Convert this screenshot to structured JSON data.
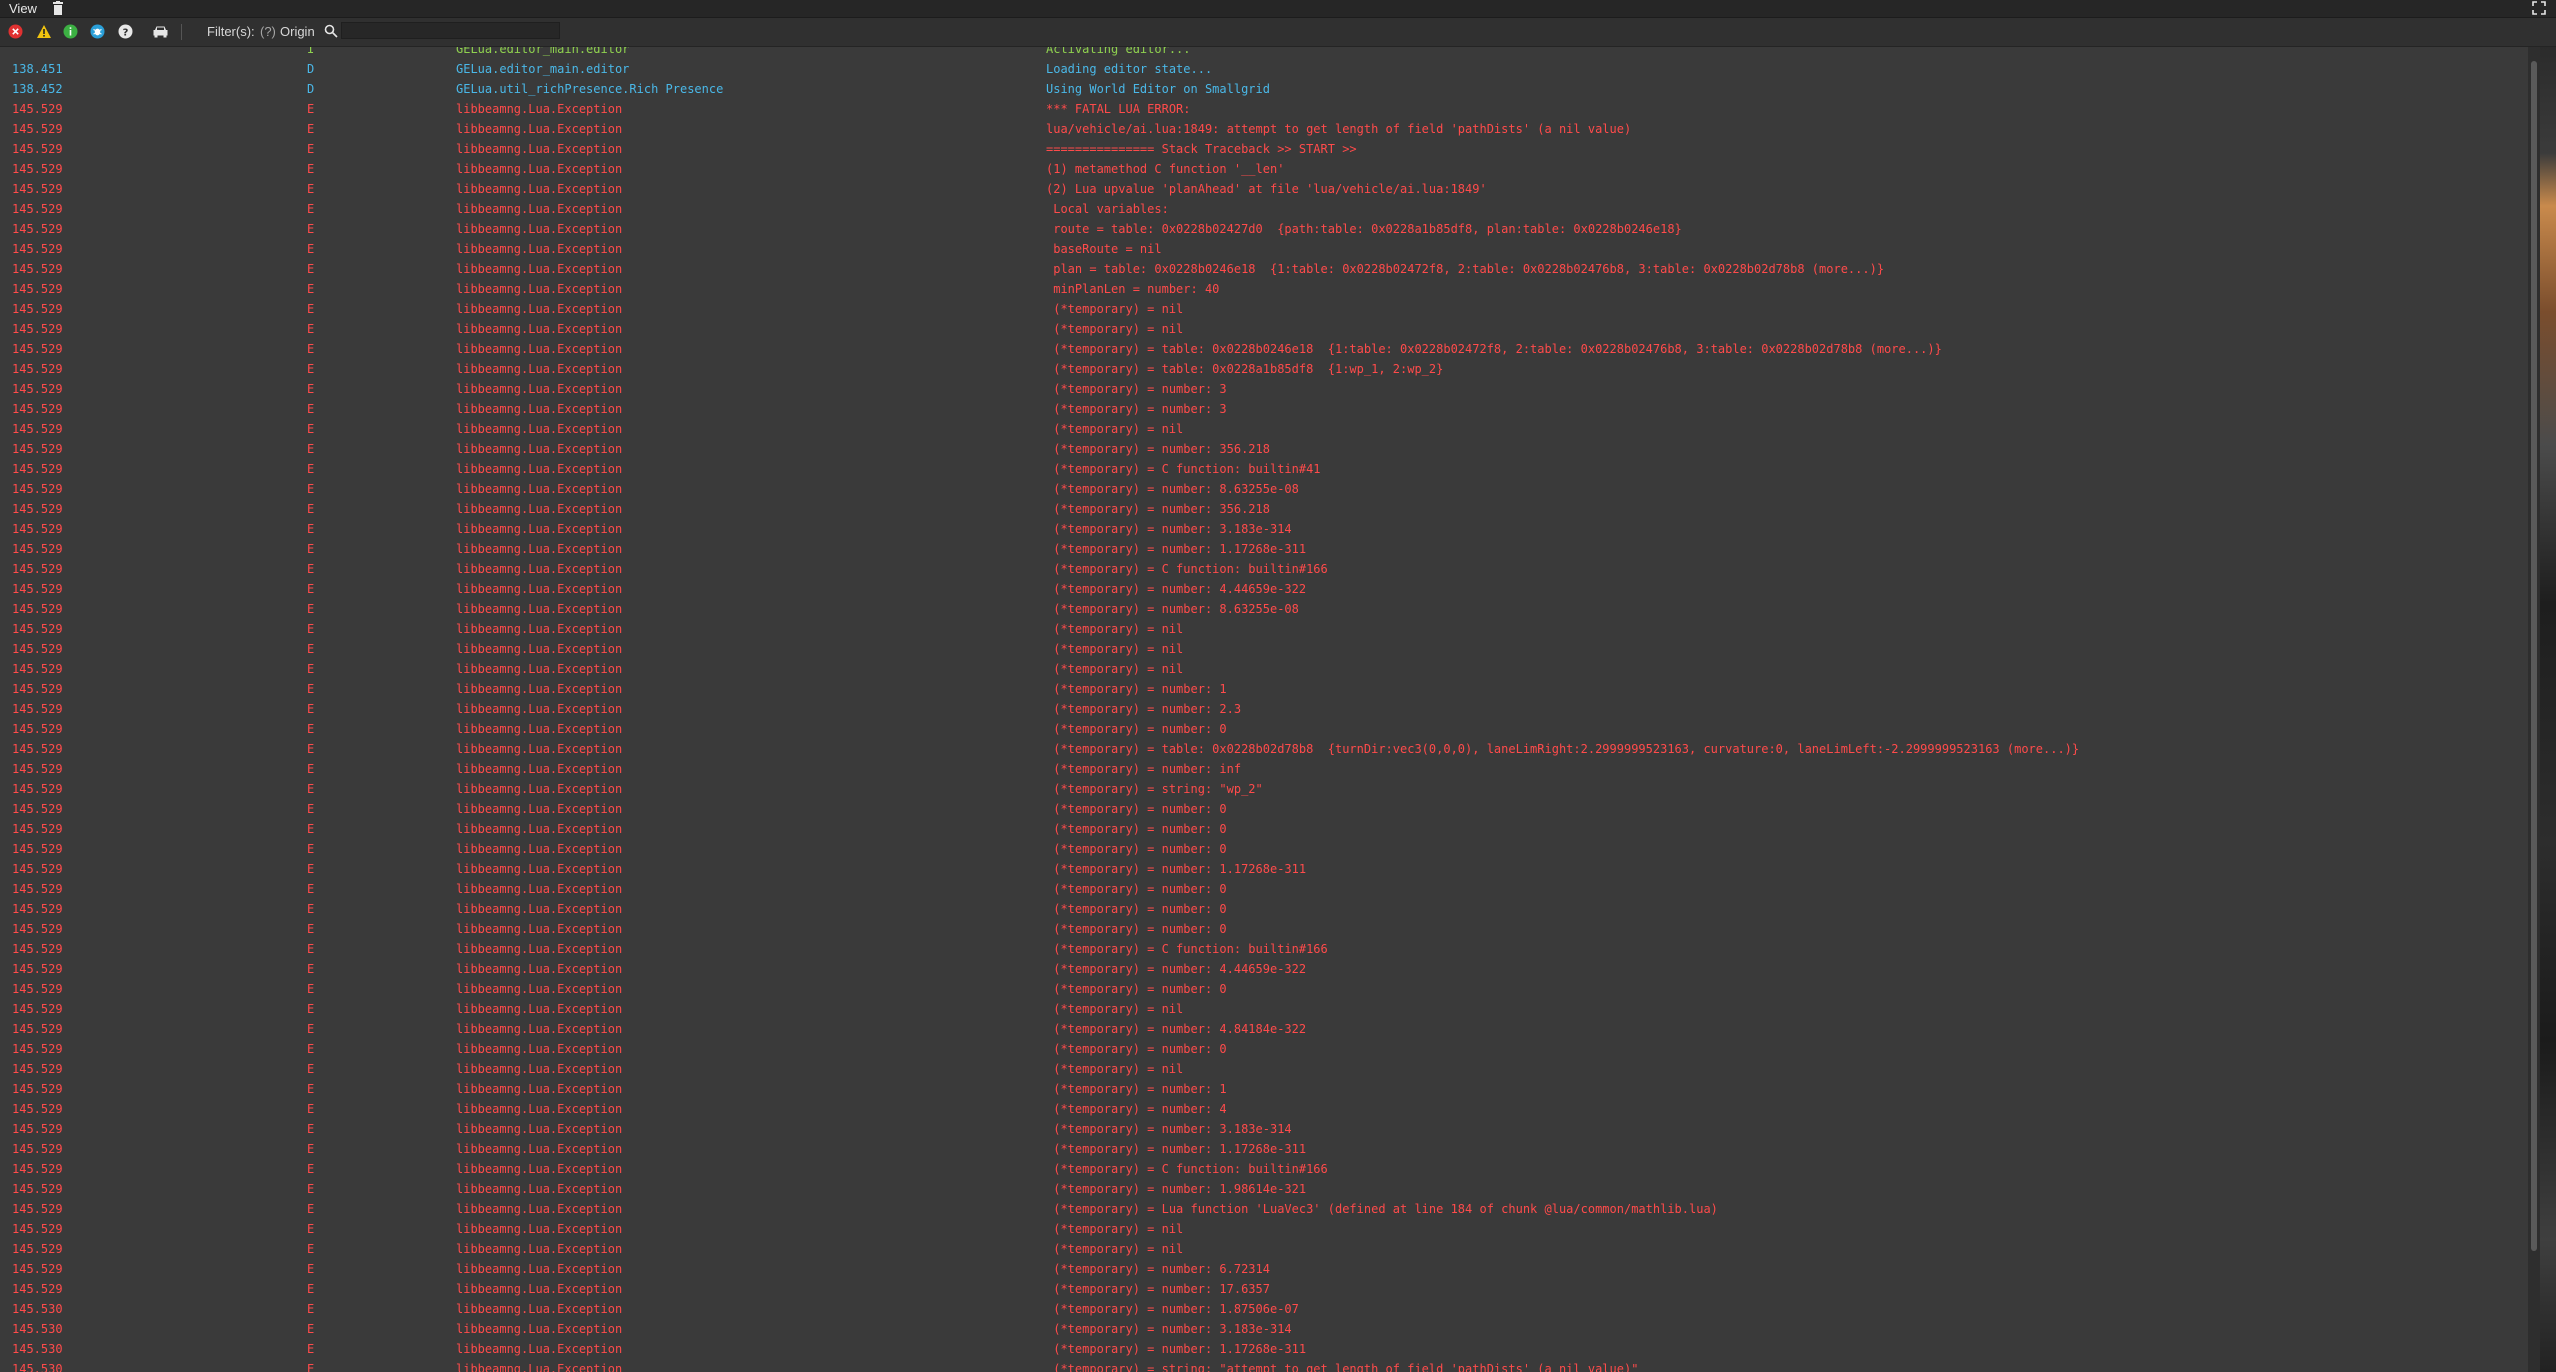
{
  "menubar": {
    "view_label": "View"
  },
  "toolbar": {
    "filters_label": "Filter(s):",
    "filters_hint": "(?)",
    "origin_label": "Origin",
    "search_value": "",
    "icons": [
      "error-filter-icon",
      "warning-filter-icon",
      "info-filter-icon",
      "debug-filter-icon",
      "help-filter-icon",
      "vehicle-icon"
    ]
  },
  "colors": {
    "debug": "#4ab8e8",
    "error": "#ff4b4b",
    "info": "#8fd14f",
    "background": "#3a3a3a"
  },
  "log": {
    "rows": [
      {
        "time": "",
        "level": "I",
        "origin": "GELua.editor_main.editor",
        "msg": "Activating editor...",
        "type": "info"
      },
      {
        "time": "138.451",
        "level": "D",
        "origin": "GELua.editor_main.editor",
        "msg": "Loading editor state...",
        "type": "debug"
      },
      {
        "time": "138.452",
        "level": "D",
        "origin": "GELua.util_richPresence.Rich Presence",
        "msg": "Using World Editor on Smallgrid",
        "type": "debug"
      },
      {
        "time": "145.529",
        "level": "E",
        "origin": "libbeamng.Lua.Exception",
        "msg": "*** FATAL LUA ERROR:",
        "type": "error"
      },
      {
        "time": "145.529",
        "level": "E",
        "origin": "libbeamng.Lua.Exception",
        "msg": "lua/vehicle/ai.lua:1849: attempt to get length of field 'pathDists' (a nil value)",
        "type": "error"
      },
      {
        "time": "145.529",
        "level": "E",
        "origin": "libbeamng.Lua.Exception",
        "msg": "=============== Stack Traceback >> START >>",
        "type": "error"
      },
      {
        "time": "145.529",
        "level": "E",
        "origin": "libbeamng.Lua.Exception",
        "msg": "(1) metamethod C function '__len'",
        "type": "error"
      },
      {
        "time": "145.529",
        "level": "E",
        "origin": "libbeamng.Lua.Exception",
        "msg": "(2) Lua upvalue 'planAhead' at file 'lua/vehicle/ai.lua:1849'",
        "type": "error"
      },
      {
        "time": "145.529",
        "level": "E",
        "origin": "libbeamng.Lua.Exception",
        "msg": " Local variables:",
        "type": "error"
      },
      {
        "time": "145.529",
        "level": "E",
        "origin": "libbeamng.Lua.Exception",
        "msg": " route = table: 0x0228b02427d0  {path:table: 0x0228a1b85df8, plan:table: 0x0228b0246e18}",
        "type": "error"
      },
      {
        "time": "145.529",
        "level": "E",
        "origin": "libbeamng.Lua.Exception",
        "msg": " baseRoute = nil",
        "type": "error"
      },
      {
        "time": "145.529",
        "level": "E",
        "origin": "libbeamng.Lua.Exception",
        "msg": " plan = table: 0x0228b0246e18  {1:table: 0x0228b02472f8, 2:table: 0x0228b02476b8, 3:table: 0x0228b02d78b8 (more...)}",
        "type": "error"
      },
      {
        "time": "145.529",
        "level": "E",
        "origin": "libbeamng.Lua.Exception",
        "msg": " minPlanLen = number: 40",
        "type": "error"
      },
      {
        "time": "145.529",
        "level": "E",
        "origin": "libbeamng.Lua.Exception",
        "msg": " (*temporary) = nil",
        "type": "error"
      },
      {
        "time": "145.529",
        "level": "E",
        "origin": "libbeamng.Lua.Exception",
        "msg": " (*temporary) = nil",
        "type": "error"
      },
      {
        "time": "145.529",
        "level": "E",
        "origin": "libbeamng.Lua.Exception",
        "msg": " (*temporary) = table: 0x0228b0246e18  {1:table: 0x0228b02472f8, 2:table: 0x0228b02476b8, 3:table: 0x0228b02d78b8 (more...)}",
        "type": "error"
      },
      {
        "time": "145.529",
        "level": "E",
        "origin": "libbeamng.Lua.Exception",
        "msg": " (*temporary) = table: 0x0228a1b85df8  {1:wp_1, 2:wp_2}",
        "type": "error"
      },
      {
        "time": "145.529",
        "level": "E",
        "origin": "libbeamng.Lua.Exception",
        "msg": " (*temporary) = number: 3",
        "type": "error"
      },
      {
        "time": "145.529",
        "level": "E",
        "origin": "libbeamng.Lua.Exception",
        "msg": " (*temporary) = number: 3",
        "type": "error"
      },
      {
        "time": "145.529",
        "level": "E",
        "origin": "libbeamng.Lua.Exception",
        "msg": " (*temporary) = nil",
        "type": "error"
      },
      {
        "time": "145.529",
        "level": "E",
        "origin": "libbeamng.Lua.Exception",
        "msg": " (*temporary) = number: 356.218",
        "type": "error"
      },
      {
        "time": "145.529",
        "level": "E",
        "origin": "libbeamng.Lua.Exception",
        "msg": " (*temporary) = C function: builtin#41",
        "type": "error"
      },
      {
        "time": "145.529",
        "level": "E",
        "origin": "libbeamng.Lua.Exception",
        "msg": " (*temporary) = number: 8.63255e-08",
        "type": "error"
      },
      {
        "time": "145.529",
        "level": "E",
        "origin": "libbeamng.Lua.Exception",
        "msg": " (*temporary) = number: 356.218",
        "type": "error"
      },
      {
        "time": "145.529",
        "level": "E",
        "origin": "libbeamng.Lua.Exception",
        "msg": " (*temporary) = number: 3.183e-314",
        "type": "error"
      },
      {
        "time": "145.529",
        "level": "E",
        "origin": "libbeamng.Lua.Exception",
        "msg": " (*temporary) = number: 1.17268e-311",
        "type": "error"
      },
      {
        "time": "145.529",
        "level": "E",
        "origin": "libbeamng.Lua.Exception",
        "msg": " (*temporary) = C function: builtin#166",
        "type": "error"
      },
      {
        "time": "145.529",
        "level": "E",
        "origin": "libbeamng.Lua.Exception",
        "msg": " (*temporary) = number: 4.44659e-322",
        "type": "error"
      },
      {
        "time": "145.529",
        "level": "E",
        "origin": "libbeamng.Lua.Exception",
        "msg": " (*temporary) = number: 8.63255e-08",
        "type": "error"
      },
      {
        "time": "145.529",
        "level": "E",
        "origin": "libbeamng.Lua.Exception",
        "msg": " (*temporary) = nil",
        "type": "error"
      },
      {
        "time": "145.529",
        "level": "E",
        "origin": "libbeamng.Lua.Exception",
        "msg": " (*temporary) = nil",
        "type": "error"
      },
      {
        "time": "145.529",
        "level": "E",
        "origin": "libbeamng.Lua.Exception",
        "msg": " (*temporary) = nil",
        "type": "error"
      },
      {
        "time": "145.529",
        "level": "E",
        "origin": "libbeamng.Lua.Exception",
        "msg": " (*temporary) = number: 1",
        "type": "error"
      },
      {
        "time": "145.529",
        "level": "E",
        "origin": "libbeamng.Lua.Exception",
        "msg": " (*temporary) = number: 2.3",
        "type": "error"
      },
      {
        "time": "145.529",
        "level": "E",
        "origin": "libbeamng.Lua.Exception",
        "msg": " (*temporary) = number: 0",
        "type": "error"
      },
      {
        "time": "145.529",
        "level": "E",
        "origin": "libbeamng.Lua.Exception",
        "msg": " (*temporary) = table: 0x0228b02d78b8  {turnDir:vec3(0,0,0), laneLimRight:2.2999999523163, curvature:0, laneLimLeft:-2.2999999523163 (more...)}",
        "type": "error"
      },
      {
        "time": "145.529",
        "level": "E",
        "origin": "libbeamng.Lua.Exception",
        "msg": " (*temporary) = number: inf",
        "type": "error"
      },
      {
        "time": "145.529",
        "level": "E",
        "origin": "libbeamng.Lua.Exception",
        "msg": " (*temporary) = string: \"wp_2\"",
        "type": "error"
      },
      {
        "time": "145.529",
        "level": "E",
        "origin": "libbeamng.Lua.Exception",
        "msg": " (*temporary) = number: 0",
        "type": "error"
      },
      {
        "time": "145.529",
        "level": "E",
        "origin": "libbeamng.Lua.Exception",
        "msg": " (*temporary) = number: 0",
        "type": "error"
      },
      {
        "time": "145.529",
        "level": "E",
        "origin": "libbeamng.Lua.Exception",
        "msg": " (*temporary) = number: 0",
        "type": "error"
      },
      {
        "time": "145.529",
        "level": "E",
        "origin": "libbeamng.Lua.Exception",
        "msg": " (*temporary) = number: 1.17268e-311",
        "type": "error"
      },
      {
        "time": "145.529",
        "level": "E",
        "origin": "libbeamng.Lua.Exception",
        "msg": " (*temporary) = number: 0",
        "type": "error"
      },
      {
        "time": "145.529",
        "level": "E",
        "origin": "libbeamng.Lua.Exception",
        "msg": " (*temporary) = number: 0",
        "type": "error"
      },
      {
        "time": "145.529",
        "level": "E",
        "origin": "libbeamng.Lua.Exception",
        "msg": " (*temporary) = number: 0",
        "type": "error"
      },
      {
        "time": "145.529",
        "level": "E",
        "origin": "libbeamng.Lua.Exception",
        "msg": " (*temporary) = C function: builtin#166",
        "type": "error"
      },
      {
        "time": "145.529",
        "level": "E",
        "origin": "libbeamng.Lua.Exception",
        "msg": " (*temporary) = number: 4.44659e-322",
        "type": "error"
      },
      {
        "time": "145.529",
        "level": "E",
        "origin": "libbeamng.Lua.Exception",
        "msg": " (*temporary) = number: 0",
        "type": "error"
      },
      {
        "time": "145.529",
        "level": "E",
        "origin": "libbeamng.Lua.Exception",
        "msg": " (*temporary) = nil",
        "type": "error"
      },
      {
        "time": "145.529",
        "level": "E",
        "origin": "libbeamng.Lua.Exception",
        "msg": " (*temporary) = number: 4.84184e-322",
        "type": "error"
      },
      {
        "time": "145.529",
        "level": "E",
        "origin": "libbeamng.Lua.Exception",
        "msg": " (*temporary) = number: 0",
        "type": "error"
      },
      {
        "time": "145.529",
        "level": "E",
        "origin": "libbeamng.Lua.Exception",
        "msg": " (*temporary) = nil",
        "type": "error"
      },
      {
        "time": "145.529",
        "level": "E",
        "origin": "libbeamng.Lua.Exception",
        "msg": " (*temporary) = number: 1",
        "type": "error"
      },
      {
        "time": "145.529",
        "level": "E",
        "origin": "libbeamng.Lua.Exception",
        "msg": " (*temporary) = number: 4",
        "type": "error"
      },
      {
        "time": "145.529",
        "level": "E",
        "origin": "libbeamng.Lua.Exception",
        "msg": " (*temporary) = number: 3.183e-314",
        "type": "error"
      },
      {
        "time": "145.529",
        "level": "E",
        "origin": "libbeamng.Lua.Exception",
        "msg": " (*temporary) = number: 1.17268e-311",
        "type": "error"
      },
      {
        "time": "145.529",
        "level": "E",
        "origin": "libbeamng.Lua.Exception",
        "msg": " (*temporary) = C function: builtin#166",
        "type": "error"
      },
      {
        "time": "145.529",
        "level": "E",
        "origin": "libbeamng.Lua.Exception",
        "msg": " (*temporary) = number: 1.98614e-321",
        "type": "error"
      },
      {
        "time": "145.529",
        "level": "E",
        "origin": "libbeamng.Lua.Exception",
        "msg": " (*temporary) = Lua function 'LuaVec3' (defined at line 184 of chunk @lua/common/mathlib.lua)",
        "type": "error"
      },
      {
        "time": "145.529",
        "level": "E",
        "origin": "libbeamng.Lua.Exception",
        "msg": " (*temporary) = nil",
        "type": "error"
      },
      {
        "time": "145.529",
        "level": "E",
        "origin": "libbeamng.Lua.Exception",
        "msg": " (*temporary) = nil",
        "type": "error"
      },
      {
        "time": "145.529",
        "level": "E",
        "origin": "libbeamng.Lua.Exception",
        "msg": " (*temporary) = number: 6.72314",
        "type": "error"
      },
      {
        "time": "145.529",
        "level": "E",
        "origin": "libbeamng.Lua.Exception",
        "msg": " (*temporary) = number: 17.6357",
        "type": "error"
      },
      {
        "time": "145.530",
        "level": "E",
        "origin": "libbeamng.Lua.Exception",
        "msg": " (*temporary) = number: 1.87506e-07",
        "type": "error"
      },
      {
        "time": "145.530",
        "level": "E",
        "origin": "libbeamng.Lua.Exception",
        "msg": " (*temporary) = number: 3.183e-314",
        "type": "error"
      },
      {
        "time": "145.530",
        "level": "E",
        "origin": "libbeamng.Lua.Exception",
        "msg": " (*temporary) = number: 1.17268e-311",
        "type": "error"
      },
      {
        "time": "145.530",
        "level": "E",
        "origin": "libbeamng.Lua.Exception",
        "msg": " (*temporary) = string: \"attempt to get length of field 'pathDists' (a nil value)\"",
        "type": "error"
      }
    ]
  }
}
